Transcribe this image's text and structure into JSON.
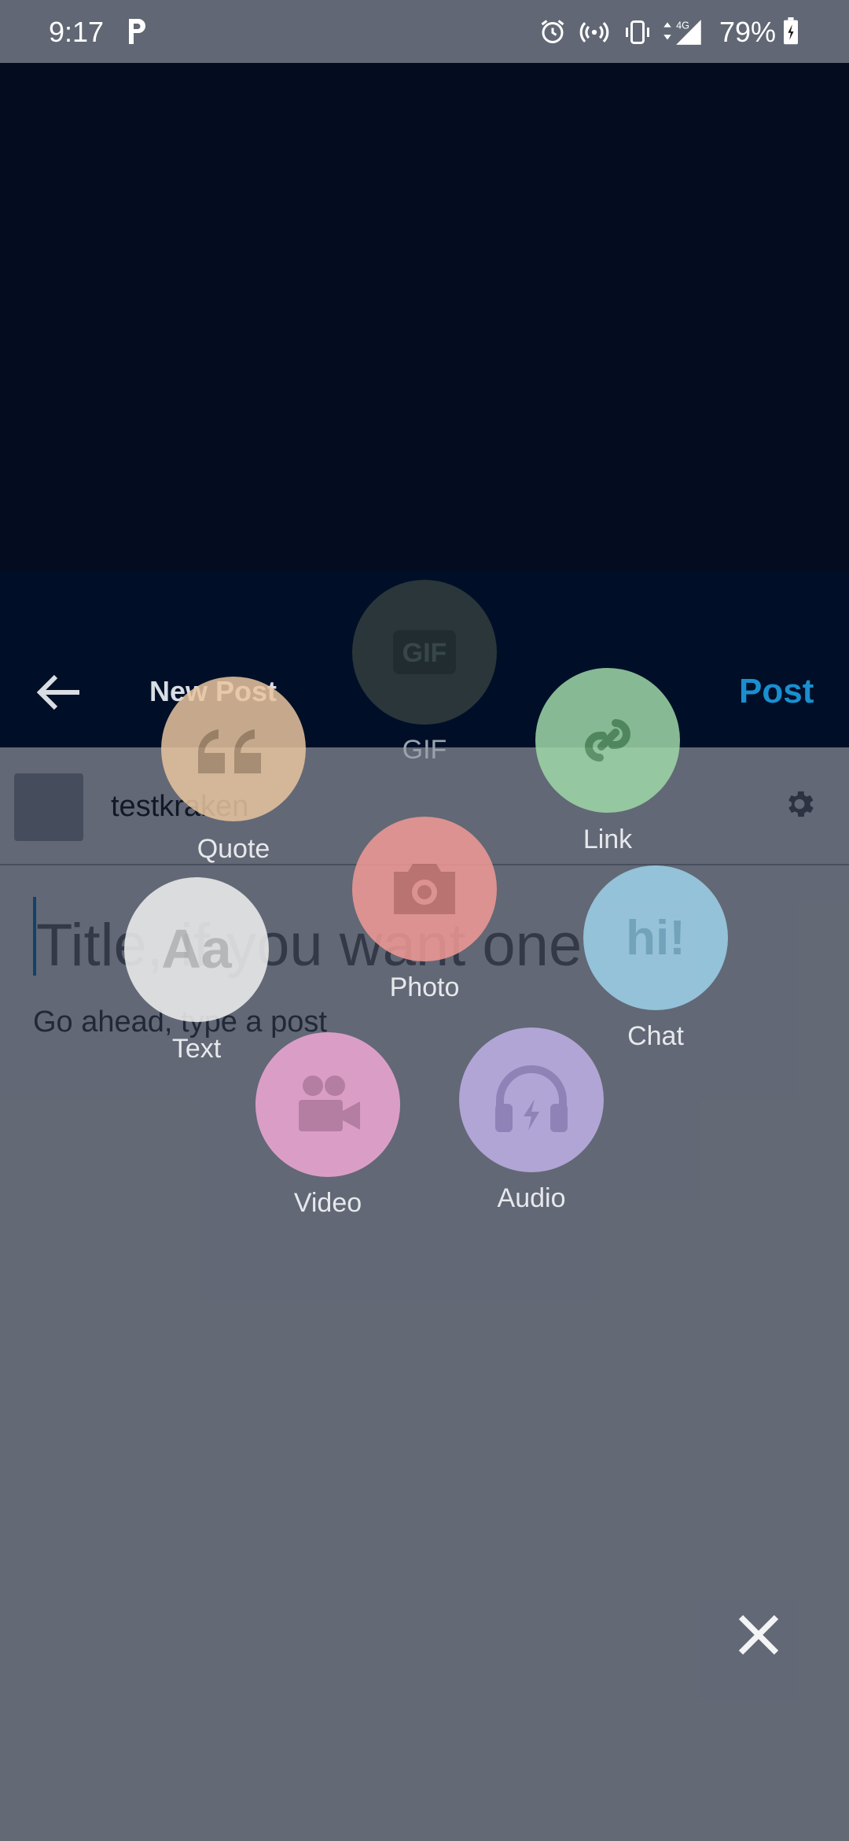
{
  "status": {
    "time": "9:17",
    "battery": "79%"
  },
  "appbar": {
    "title": "New Post",
    "post_label": "Post"
  },
  "account": {
    "name": "testkraken"
  },
  "editor": {
    "title_placeholder": "Title, if you want one",
    "body_placeholder": "Go ahead, type a post"
  },
  "post_types": [
    {
      "label": "GIF",
      "color": "#2f3b3d",
      "icon": "gif-icon"
    },
    {
      "label": "Quote",
      "color": "#f2c79b",
      "icon": "quote-icon"
    },
    {
      "label": "Link",
      "color": "#9fd8a8",
      "icon": "link-icon"
    },
    {
      "label": "Photo",
      "color": "#f29a95",
      "icon": "camera-icon"
    },
    {
      "label": "Text",
      "color": "#ececec",
      "icon": "text-icon"
    },
    {
      "label": "Chat",
      "color": "#9ed2ea",
      "icon": "chat-icon"
    },
    {
      "label": "Video",
      "color": "#f0a8d5",
      "icon": "video-camera-icon"
    },
    {
      "label": "Audio",
      "color": "#bfb0e8",
      "icon": "headphones-icon"
    }
  ],
  "colors": {
    "accent": "#1a8fd0",
    "appbar_bg": "#001935"
  }
}
